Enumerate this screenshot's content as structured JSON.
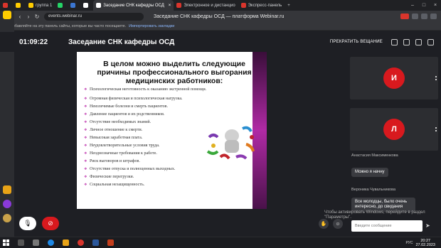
{
  "browser": {
    "tabs": [
      {
        "label": "",
        "color": "#d9352c"
      },
      {
        "label": "",
        "color": "#ffcc00"
      },
      {
        "label": "группа 1",
        "color": "#ffcc00"
      },
      {
        "label": "",
        "color": "#25d366"
      },
      {
        "label": "",
        "color": "#3b76d1"
      },
      {
        "label": "",
        "color": "#ffffff"
      },
      {
        "label": "Заседание СНК кафедры ОСД",
        "color": "#ffffff",
        "active": true
      },
      {
        "label": "Электронное и дистанцио",
        "color": "#d9352c"
      },
      {
        "label": "Экспресс-панель",
        "color": "#d9352c"
      }
    ],
    "url": "events.webinar.ru",
    "page_title": "Заседание СНК кафедры ОСД — платформа Webinar.ru",
    "bookmark_hint": "Добавляйте на эту панель сайты, которые вы часто посещаете.",
    "bookmark_link": "Импортировать закладки",
    "ext_badge": "ABP"
  },
  "app": {
    "timer": "01:09:22",
    "title": "Заседание СНК кафедры ОСД",
    "stop_label": "ПРЕКРАТИТЬ ВЕЩАНИЕ"
  },
  "slide": {
    "heading": "В целом можно выделить следующие причины профессионального выгорания медицинских работников:",
    "bullets": [
      "Психологическая неготовность к оказанию экстренной помощи.",
      "Огромная физическая и психологическая нагрузка.",
      "Неизлечимые болезни и смерть пациентов.",
      "Давление пациентов и их родственников.",
      "Отсутствие необходимых знаний.",
      "Личное отношение к смерти.",
      "Невысокая заработная плата.",
      "Неудовлетворительные условия труда.",
      "Неоднозначные требования к работе.",
      "Риск выговоров и штрафов.",
      "Отсутствие отпуска и полноценных выходных.",
      "Физические перегрузки.",
      "Социальная незащищенность."
    ]
  },
  "participants": [
    {
      "initial": "И",
      "name": ""
    },
    {
      "initial": "Л",
      "name": "Анастасия Максименкова"
    }
  ],
  "chat": {
    "messages": [
      {
        "author": "Анастасия Максименкова",
        "text": "Можно я начну"
      },
      {
        "author": "Вероника Чувальникова",
        "text": "Все молодцы, было очень интересно, до свидания"
      }
    ],
    "activate_notice": "Чтобы активировать Windows, перейдите в раздел \"Параметры\".",
    "input_placeholder": "Введите сообщение",
    "send_icon": "send-icon"
  },
  "taskbar": {
    "time": "20:27",
    "date": "27.02.2023",
    "lang": "РУС"
  },
  "colors": {
    "accent_red": "#d8191e",
    "slide_band": "#b02aa5"
  }
}
